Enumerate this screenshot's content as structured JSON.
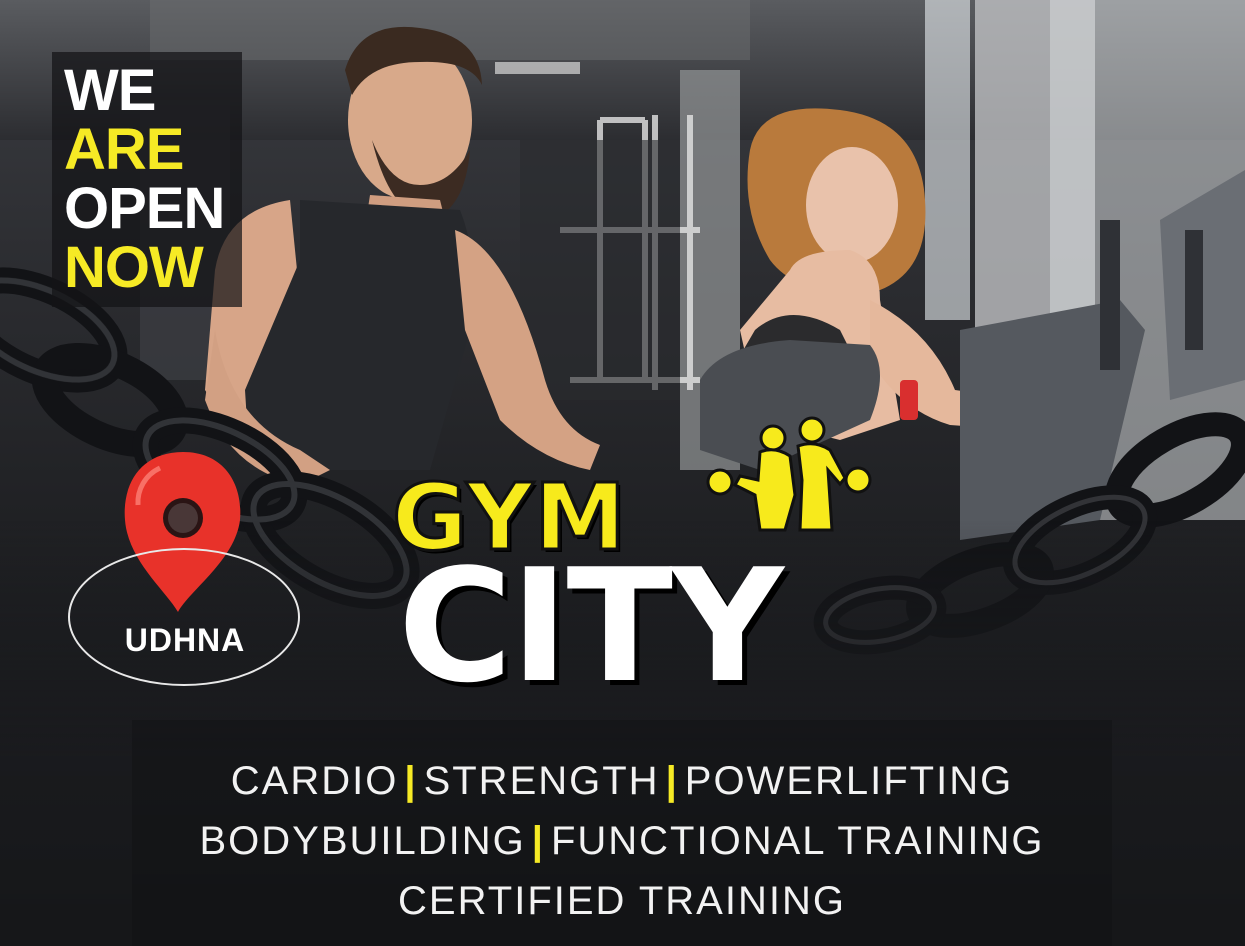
{
  "headline": {
    "line1": "WE",
    "line2": "ARE",
    "line3": "OPEN",
    "line4": "NOW"
  },
  "brand": {
    "word1": "GYM",
    "word2": "CITY",
    "accent_color": "#f6ea25"
  },
  "location": {
    "name": "UDHNA",
    "icon": "map-pin-icon",
    "pin_color": "#e8322a"
  },
  "services": {
    "line1": [
      "CARDIO",
      "STRENGTH",
      "POWERLIFTING"
    ],
    "line2": [
      "BODYBUILDING",
      "FUNCTIONAL TRAINING"
    ],
    "line3": [
      "CERTIFIED TRAINING"
    ],
    "separator": "|"
  }
}
